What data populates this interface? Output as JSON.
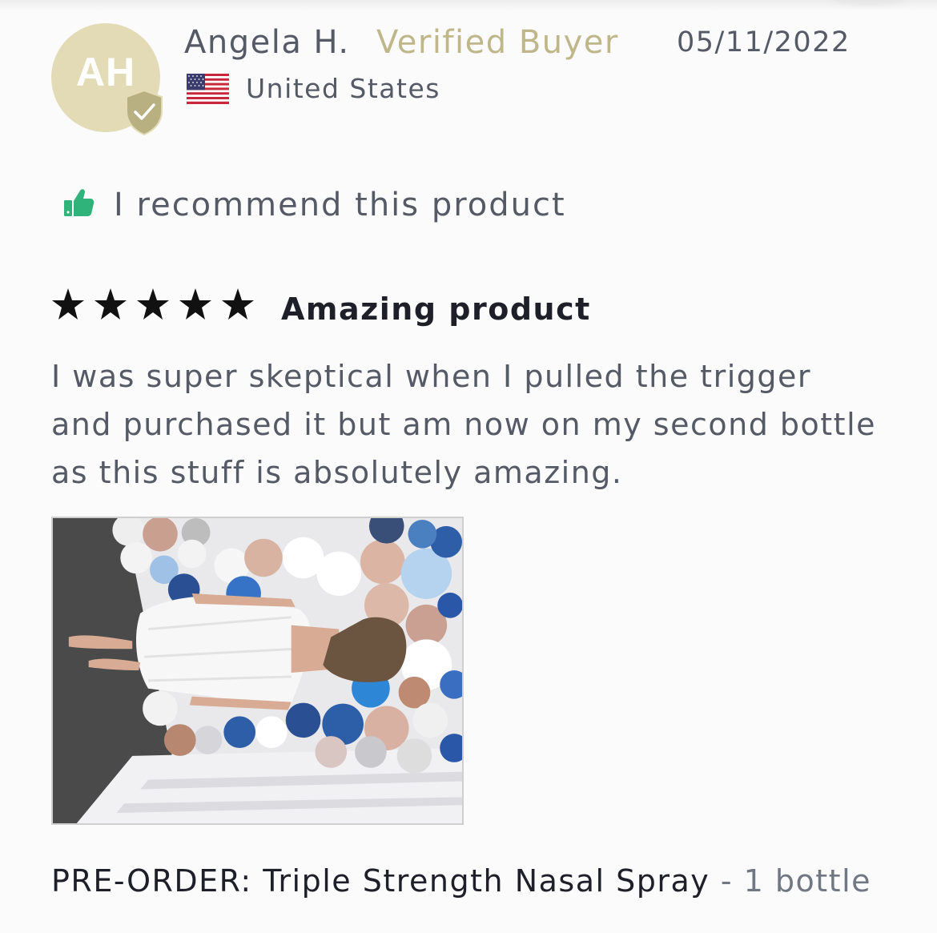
{
  "reviewer": {
    "initials": "AH",
    "name": "Angela H.",
    "badge": "Verified Buyer",
    "country": "United States",
    "date": "05/11/2022"
  },
  "recommendation": {
    "text": "I recommend this product",
    "icon": "thumbs-up-icon",
    "color": "#2fb37a"
  },
  "review": {
    "rating": 5,
    "max_rating": 5,
    "title": "Amazing product",
    "body": "I was super skeptical when I pulled the trigger and purchased it but am now on my second bottle as this stuff is absolutely amazing."
  },
  "photo": {
    "icon": "review-photo"
  },
  "product": {
    "name": "PRE-ORDER: Triple Strength Nasal Spray",
    "variant": " - 1 bottle"
  },
  "colors": {
    "avatar_bg": "#e3dbb6",
    "verified": "#bfb78a",
    "badge": "#b8b081",
    "text": "#555a66",
    "title": "#1f1f2a"
  }
}
